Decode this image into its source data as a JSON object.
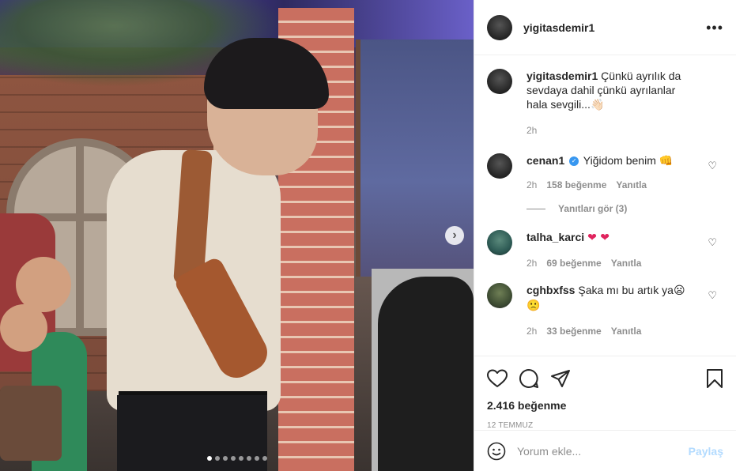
{
  "post": {
    "username": "yigitasdemir1",
    "caption_user": "yigitasdemir1",
    "caption_text": "Çünkü ayrılık da sevdaya dahil çünkü ayrılanlar hala sevgili...",
    "caption_emoji": "👋🏻",
    "caption_time": "2h",
    "slide_count": 8,
    "active_slide": 1
  },
  "comments": [
    {
      "user": "cenan1",
      "verified": true,
      "text": "Yiğidom benim",
      "emoji": "👊",
      "time": "2h",
      "likes": "158 beğenme",
      "reply": "Yanıtla",
      "view_replies": "Yanıtları gör (3)"
    },
    {
      "user": "talha_karci",
      "verified": false,
      "text": "",
      "emoji": "❤ ❤",
      "time": "2h",
      "likes": "69 beğenme",
      "reply": "Yanıtla"
    },
    {
      "user": "cghbxfss",
      "verified": false,
      "text": "Şaka mı bu artık ya",
      "emoji": "😦 🙁",
      "time": "2h",
      "likes": "33 beğenme",
      "reply": "Yanıtla"
    }
  ],
  "footer": {
    "likes": "2.416 beğenme",
    "date": "12 TEMMUZ",
    "comment_placeholder": "Yorum ekle...",
    "share_label": "Paylaş"
  },
  "icons": {
    "more": "more-options-icon",
    "like": "heart-icon",
    "comment": "comment-icon",
    "share": "send-icon",
    "save": "bookmark-icon",
    "emoji": "emoji-icon",
    "next": "chevron-right-icon"
  },
  "colors": {
    "accent_link": "#b3dbff",
    "verified": "#3897f0",
    "muted": "#8e8e8e"
  }
}
